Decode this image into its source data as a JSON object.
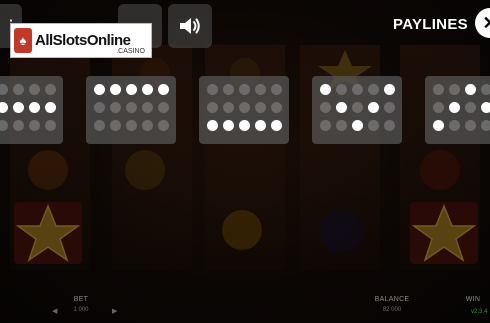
{
  "top_bar": {
    "logo": {
      "brand": "AllSlotsOnline",
      "sub": ".CASINO"
    },
    "paylines_title": "PAYLINES",
    "close_symbol": "✕"
  },
  "paylines": [
    {
      "rows": [
        [
          0,
          0,
          0,
          0,
          0
        ],
        [
          1,
          1,
          1,
          1,
          1
        ],
        [
          0,
          0,
          0,
          0,
          0
        ]
      ]
    },
    {
      "rows": [
        [
          1,
          1,
          1,
          1,
          1
        ],
        [
          0,
          0,
          0,
          0,
          0
        ],
        [
          0,
          0,
          0,
          0,
          0
        ]
      ]
    },
    {
      "rows": [
        [
          0,
          0,
          0,
          0,
          0
        ],
        [
          0,
          0,
          0,
          0,
          0
        ],
        [
          1,
          1,
          1,
          1,
          1
        ]
      ]
    },
    {
      "rows": [
        [
          1,
          0,
          0,
          0,
          1
        ],
        [
          0,
          1,
          0,
          1,
          0
        ],
        [
          0,
          0,
          1,
          0,
          0
        ]
      ]
    },
    {
      "rows": [
        [
          0,
          0,
          1,
          0,
          0
        ],
        [
          0,
          1,
          0,
          1,
          0
        ],
        [
          1,
          0,
          0,
          0,
          1
        ]
      ]
    }
  ],
  "bottom": {
    "bet_label": "BET",
    "bet_value": "1 000",
    "balance_label": "BALANCE",
    "balance_value": "82 000",
    "win_label": "WIN",
    "version": "v2.3.4"
  },
  "icons": {
    "menu": "menu-icon",
    "sound": "speaker-icon",
    "close": "close-icon"
  }
}
